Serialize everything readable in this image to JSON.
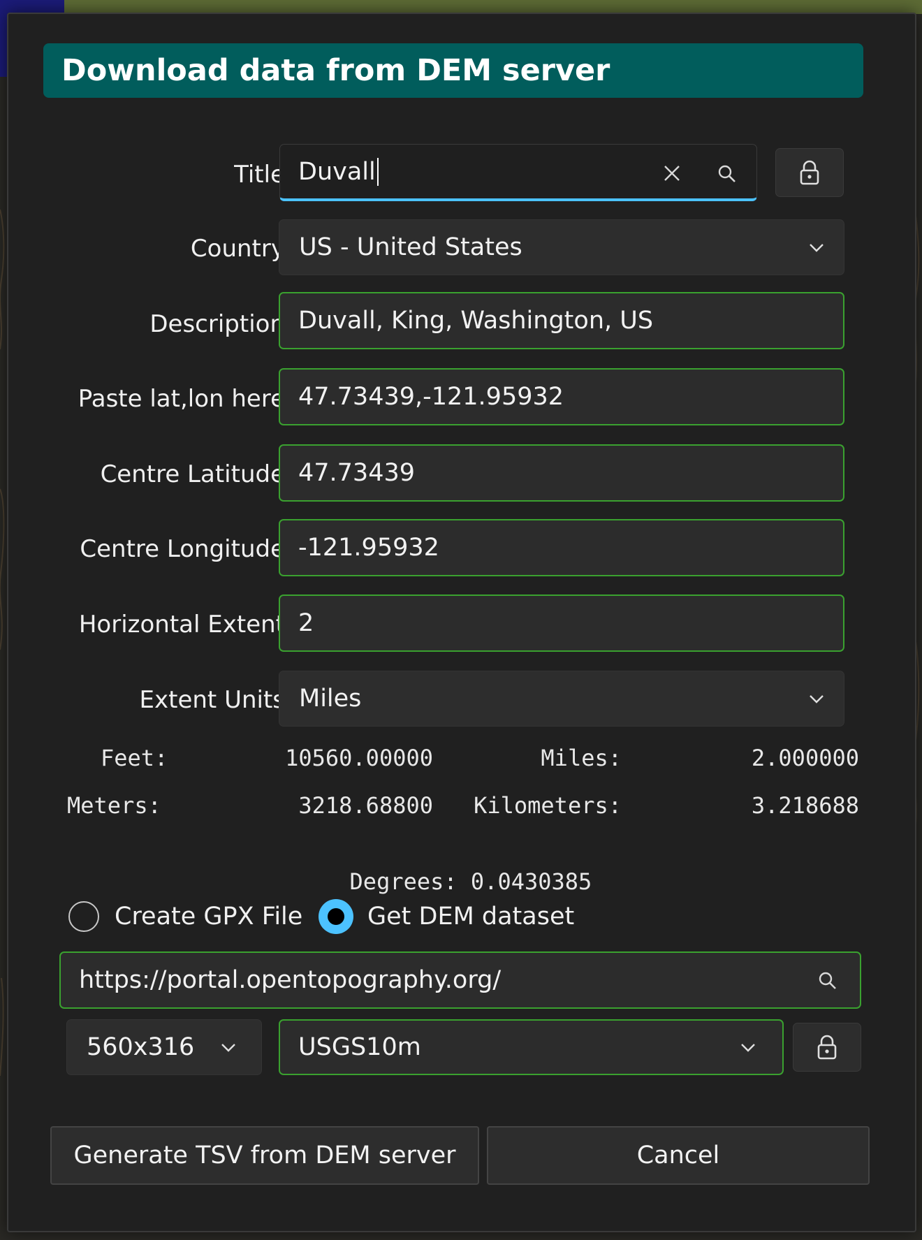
{
  "dialog": {
    "title": "Download data from DEM server"
  },
  "form": {
    "title": {
      "label": "Title",
      "value": "Duvall"
    },
    "country": {
      "label": "Country",
      "value": "US - United States"
    },
    "description": {
      "label": "Description",
      "value": "Duvall, King, Washington, US"
    },
    "paste_latlon": {
      "label": "Paste lat,lon here",
      "value": "47.73439,-121.95932"
    },
    "centre_latitude": {
      "label": "Centre Latitude",
      "value": "47.73439"
    },
    "centre_longitude": {
      "label": "Centre Longitude",
      "value": "-121.95932"
    },
    "horizontal_extent": {
      "label": "Horizontal Extent",
      "value": "2"
    },
    "extent_units": {
      "label": "Extent Units",
      "value": "Miles"
    }
  },
  "conversions": {
    "feet_label": "Feet:",
    "feet_value": "10560.00000",
    "miles_label": "Miles:",
    "miles_value": "2.000000",
    "meters_label": "Meters:",
    "meters_value": "3218.68800",
    "kilometers_label": "Kilometers:",
    "kilometers_value": "3.218688",
    "degrees_label": "Degrees:",
    "degrees_value": "0.0430385"
  },
  "mode": {
    "create_gpx_label": "Create GPX File",
    "create_gpx_selected": false,
    "get_dem_label": "Get DEM dataset",
    "get_dem_selected": true
  },
  "server": {
    "url": "https://portal.opentopography.org/",
    "resolution": "560x316",
    "dataset": "USGS10m"
  },
  "buttons": {
    "generate_label": "Generate TSV from DEM server",
    "cancel_label": "Cancel"
  },
  "icons": {
    "clear": "close-icon",
    "search": "search-icon",
    "lock": "lock-icon",
    "dropdown": "chevron-down-icon"
  },
  "colors": {
    "title_bar": "#015d5c",
    "field_border": "#3aa12f",
    "focus_underline": "#4cc2ff",
    "radio_accent": "#4cc2ff"
  }
}
